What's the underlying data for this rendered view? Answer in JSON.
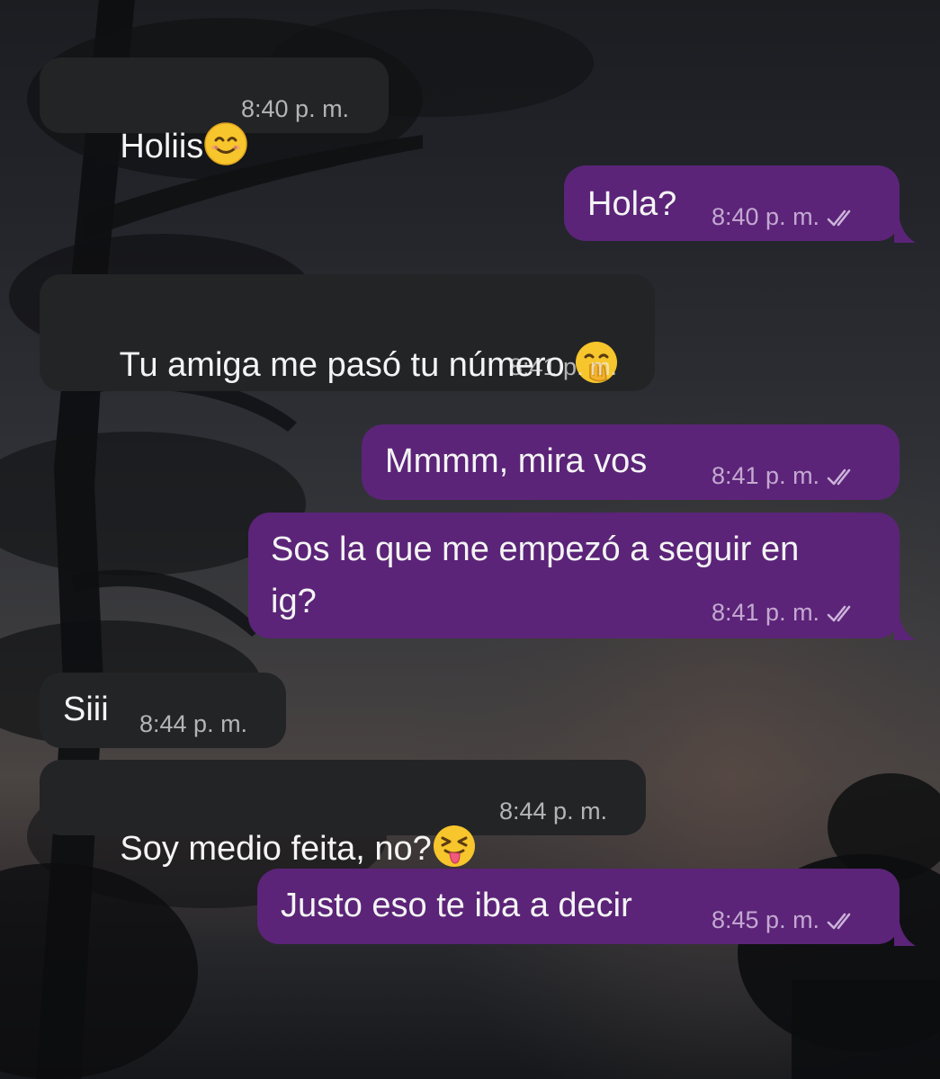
{
  "messages": [
    {
      "direction": "in",
      "text": "Holiis",
      "emoji": "smiling-face-icon",
      "time": "8:40 p. m."
    },
    {
      "direction": "out",
      "text": "Hola?",
      "time": "8:40 p. m.",
      "status": "read"
    },
    {
      "direction": "in",
      "text": "Tu amiga me pasó tu número",
      "emoji": "face-with-hand-over-mouth-icon",
      "time": "8:41 p. m."
    },
    {
      "direction": "out",
      "text": "Mmmm, mira vos",
      "time": "8:41 p. m.",
      "status": "read"
    },
    {
      "direction": "out",
      "text_line1": "Sos la que me empezó a seguir en",
      "text_line2": "ig?",
      "time": "8:41 p. m.",
      "status": "read"
    },
    {
      "direction": "in",
      "text": "Siii",
      "time": "8:44 p. m."
    },
    {
      "direction": "in",
      "text": "Soy medio feita, no?",
      "emoji": "squinting-face-with-tongue-icon",
      "time": "8:44 p. m."
    },
    {
      "direction": "out",
      "text": "Justo eso te iba a decir",
      "time": "8:45 p. m.",
      "status": "read"
    }
  ],
  "colors": {
    "incoming_bubble": "#232426",
    "outgoing_bubble": "#5b2478",
    "text": "#f4f4f4"
  }
}
